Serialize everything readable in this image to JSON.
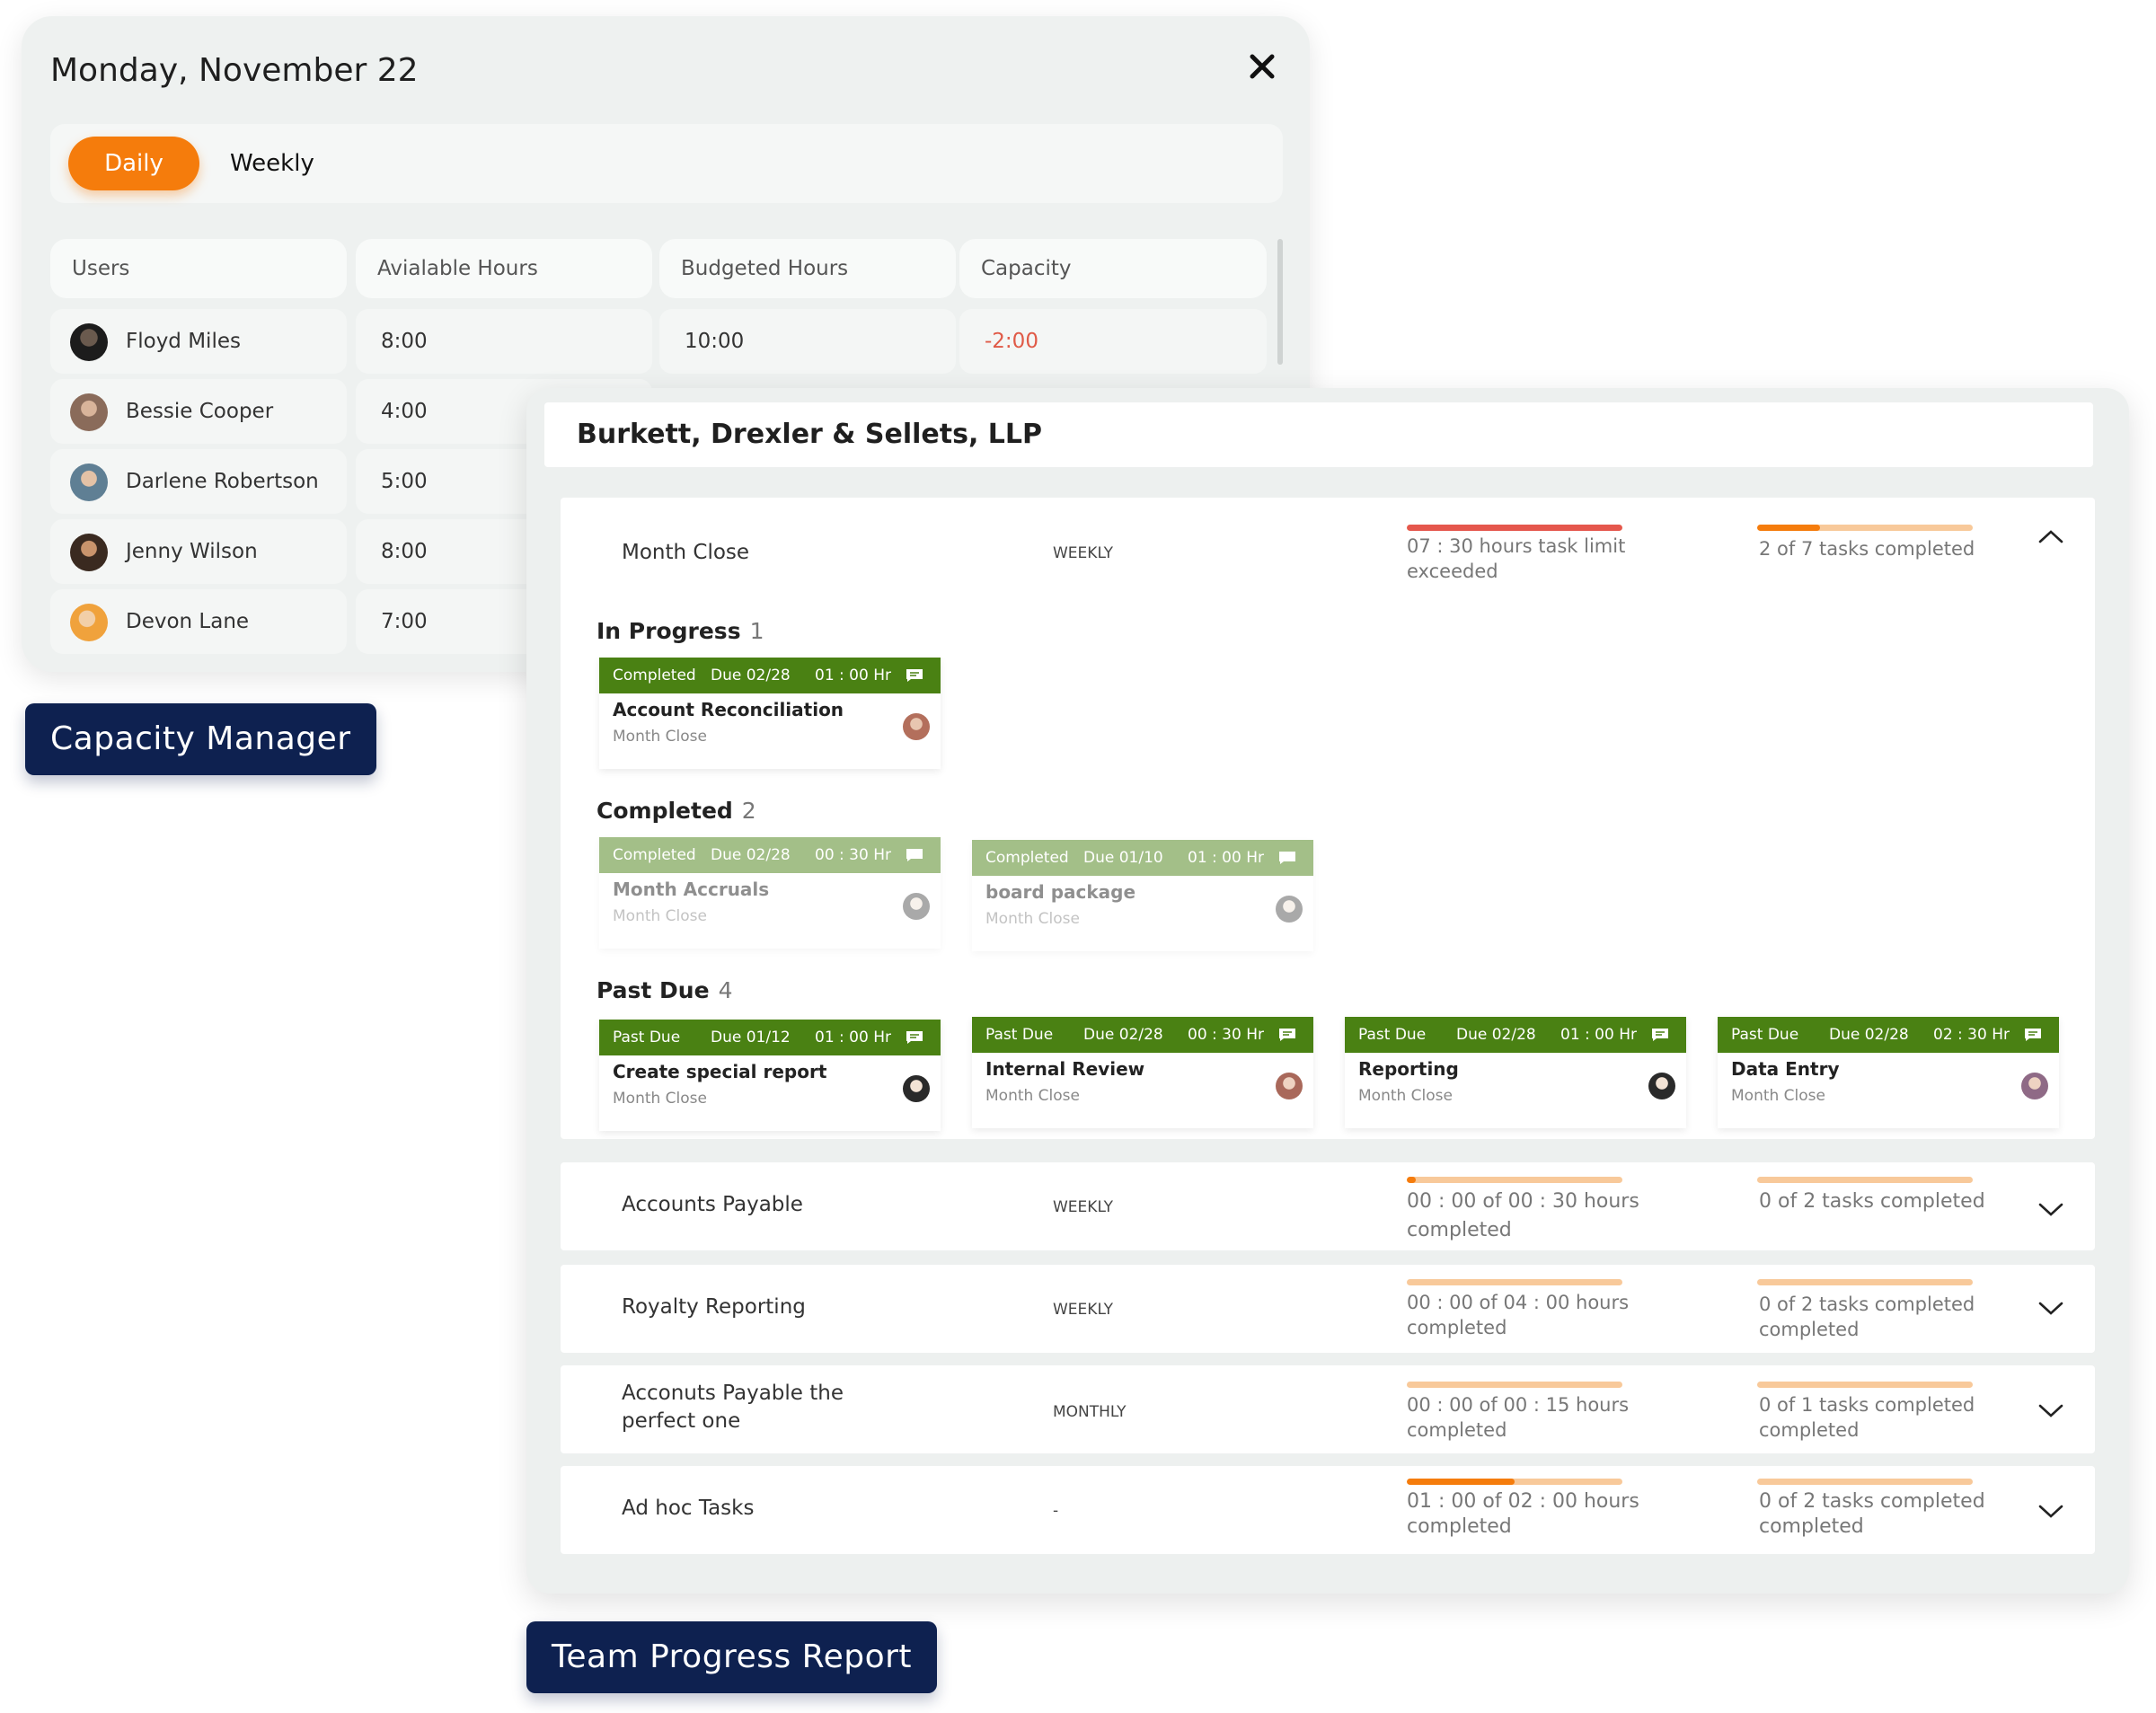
{
  "capacity": {
    "date": "Monday, November 22",
    "tabs": {
      "daily": "Daily",
      "weekly": "Weekly"
    },
    "columns": [
      "Users",
      "Avialable Hours",
      "Budgeted Hours",
      "Capacity"
    ],
    "rows": [
      {
        "name": "Floyd Miles",
        "available": "8:00",
        "budgeted": "10:00",
        "capacity": "-2:00"
      },
      {
        "name": "Bessie Cooper",
        "available": "4:00"
      },
      {
        "name": "Darlene Robertson",
        "available": "5:00"
      },
      {
        "name": "Jenny Wilson",
        "available": "8:00"
      },
      {
        "name": "Devon Lane",
        "available": "7:00"
      }
    ],
    "negative_color": "#e05a47",
    "accent": "#f57c0c"
  },
  "labels": {
    "capacity_manager": "Capacity Manager",
    "team_progress": "Team Progress Report"
  },
  "report": {
    "title": "Burkett, Drexler & Sellets, LLP",
    "expanded": {
      "name": "Month Close",
      "freq": "WEEKLY",
      "hours_text": "07 : 30 hours task limit exceeded",
      "hours_progress": 1.0,
      "tasks_text": "2 of 7 tasks completed",
      "tasks_progress": 0.29,
      "sections": {
        "in_progress": {
          "label": "In Progress",
          "count": "1",
          "cards": [
            {
              "status": "Completed",
              "due": "Due 02/28",
              "hours": "01 : 00 Hr",
              "title": "Account Reconciliation",
              "sub": "Month Close"
            }
          ]
        },
        "completed": {
          "label": "Completed",
          "count": "2",
          "cards": [
            {
              "status": "Completed",
              "due": "Due 02/28",
              "hours": "00 : 30 Hr",
              "title": "Month Accruals",
              "sub": "Month Close"
            },
            {
              "status": "Completed",
              "due": "Due 01/10",
              "hours": "01 : 00 Hr",
              "title": "board package",
              "sub": "Month Close"
            }
          ]
        },
        "past_due": {
          "label": "Past Due",
          "count": "4",
          "cards": [
            {
              "status": "Past Due",
              "due": "Due 01/12",
              "hours": "01 : 00 Hr",
              "title": "Create special report",
              "sub": "Month Close"
            },
            {
              "status": "Past Due",
              "due": "Due 02/28",
              "hours": "00 : 30 Hr",
              "title": "Internal Review",
              "sub": "Month Close"
            },
            {
              "status": "Past Due",
              "due": "Due 02/28",
              "hours": "01 : 00 Hr",
              "title": "Reporting",
              "sub": "Month Close"
            },
            {
              "status": "Past Due",
              "due": "Due 02/28",
              "hours": "02 : 30 Hr",
              "title": "Data Entry",
              "sub": "Month Close"
            }
          ]
        }
      }
    },
    "groups": [
      {
        "name": "Accounts Payable",
        "freq": "WEEKLY",
        "hours_text": "00 : 00 of 00 : 30 hours completed",
        "hours_progress": 0.04,
        "tasks_text": "0 of 2 tasks completed",
        "tasks_progress": 0
      },
      {
        "name": "Royalty Reporting",
        "freq": "WEEKLY",
        "hours_text": "00 : 00 of 04 : 00 hours completed",
        "hours_progress": 0,
        "tasks_text": "0 of 2 tasks completed completed",
        "tasks_progress": 0
      },
      {
        "name": "Acconuts Payable the perfect one",
        "freq": "MONTHLY",
        "hours_text": "00 : 00 of 00 : 15 hours completed",
        "hours_progress": 0,
        "tasks_text": "0 of 1 tasks completed completed",
        "tasks_progress": 0
      },
      {
        "name": "Ad hoc Tasks",
        "freq": "-",
        "hours_text": "01 : 00 of 02 : 00 hours completed",
        "hours_progress": 0.5,
        "tasks_text": "0 of 2 tasks completed completed",
        "tasks_progress": 0
      }
    ],
    "card_header_color": "#4a8113"
  }
}
